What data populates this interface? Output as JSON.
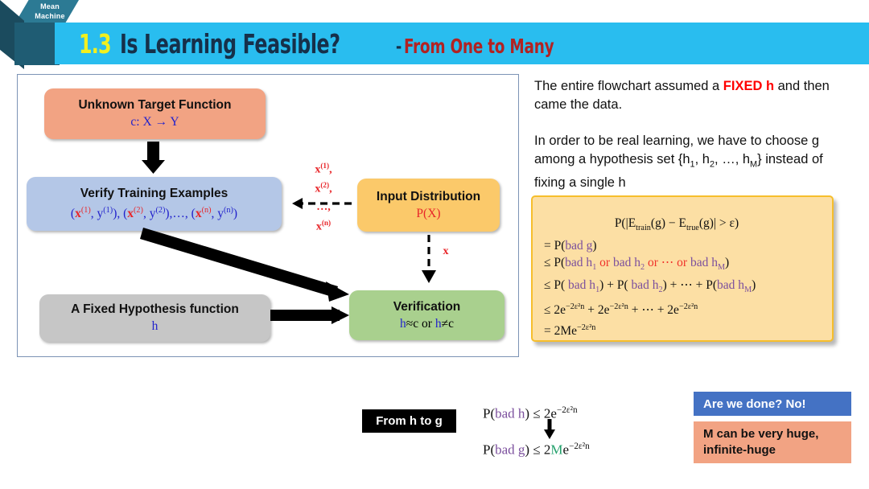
{
  "header": {
    "logo_line1": "Mean",
    "logo_line2": "Machine",
    "number": "1.3",
    "title": "Is Learning Feasible?",
    "dash": "-",
    "subtitle": "From One to Many",
    "bar_color": "#29BDEF",
    "number_color": "#F2F01E",
    "title_color": "#16304A",
    "subtitle_color": "#B22222"
  },
  "flowchart": {
    "target": {
      "title": "Unknown Target Function",
      "formula_prefix": "c: X",
      "formula_arrow": "→",
      "formula_suffix": "Y",
      "color": "#F2A383"
    },
    "verify": {
      "title": "Verify Training Examples",
      "color": "#B4C7E7"
    },
    "hypothesis": {
      "title": "A Fixed Hypothesis function",
      "symbol": "h",
      "color": "#C6C6C6"
    },
    "input": {
      "title": "Input Distribution",
      "formula": "P(X)",
      "color": "#FBC96A"
    },
    "verification": {
      "title": "Verification",
      "formula_a": "h",
      "formula_approx": "≈",
      "formula_b": "c or",
      "formula_c": "h",
      "formula_neq": "≠",
      "formula_d": "c",
      "color": "#A9D08E"
    },
    "sample_labels": {
      "l1": "x",
      "l1sup": "(1)",
      "l2": "x",
      "l2sup": "(2)",
      "l3": "…,",
      "l4": "x",
      "l4sup": "(n)",
      "dashed_label": "x",
      "color": "#E8262A"
    }
  },
  "right": {
    "para1_a": "The entire flowchart assumed a ",
    "para1_fixed": "FIXED h",
    "para1_b": " and then came the data.",
    "para2": "In order to be real learning, we have to choose g among a hypothesis set {h",
    "para2_sub1": "1",
    "para2_mid": ", h",
    "para2_sub2": "2",
    "para2_mid2": ", …, h",
    "para2_sub3": "M",
    "para2_end": "} instead of fixing a single h"
  },
  "formula_box": {
    "border_color": "#F6BE2C",
    "fill_color": "#FCDFA4",
    "line0": "P(|E",
    "line0_sub1": "train",
    "line0_mid": "(g) − E",
    "line0_sub2": "true",
    "line0_end": "(g)| > ε)",
    "line1_op": "= P(",
    "line1_badg": "bad g",
    "line1_close": ")",
    "line2_op": "≤ P(",
    "line2_h1": "bad h",
    "line2_h1sub": "1",
    "line2_or1": " or ",
    "line2_h2": "bad h",
    "line2_h2sub": "2",
    "line2_or2": " or ",
    "line2_dots": "⋯",
    "line2_or3": " or ",
    "line2_hM": "bad h",
    "line2_hMsub": "M",
    "line2_close": ")",
    "line3_op": "≤ P( ",
    "line3_h1": "bad h",
    "line3_h1sub": "1",
    "line3_plus1": ") + P( ",
    "line3_h2": "bad h",
    "line3_h2sub": "2",
    "line3_plus2": ") + ⋯ + P(",
    "line3_hM": "bad h",
    "line3_hMsub": "M",
    "line3_close": ")",
    "line4": "≤ 2e",
    "line4_exp": "−2ε²n",
    "line4_b": " + 2e",
    "line4_exp2": "−2ε²n",
    "line4_c": " + ⋯ + 2e",
    "line4_exp3": "−2ε²n",
    "line5": "= 2Me",
    "line5_exp": "−2ε²n",
    "bad_color": "#7B4F9D",
    "or_color": "#F0322B"
  },
  "bottom": {
    "from_h_to_g": "From h to g",
    "f1_a": "P(",
    "f1_bad": "bad h",
    "f1_b": ") ≤ 2e",
    "f1_exp": "−2ε²n",
    "f2_a": "P(",
    "f2_bad": "bad g",
    "f2_b": ") ≤ 2",
    "f2_m": "M",
    "f2_c": "e",
    "f2_exp": "−2ε²n",
    "done_label": "Are we done? No!",
    "done_color": "#4472C4",
    "huge_line1": "M can be very huge,",
    "huge_line2": "infinite-huge",
    "huge_color": "#F2A383"
  }
}
